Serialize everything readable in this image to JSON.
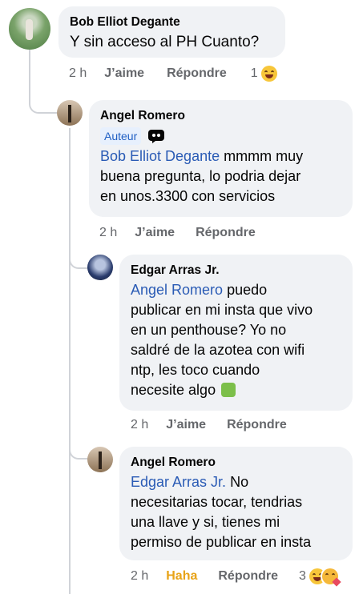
{
  "comments": [
    {
      "author": "Bob Elliot Degante",
      "text": "Y sin acceso al PH Cuanto?",
      "time": "2 h",
      "like": "J’aime",
      "reply": "Répondre",
      "reaction_count": "1"
    },
    {
      "author": "Angel Romero",
      "badge": "Auteur",
      "mention": "Bob Elliot Degante",
      "text_l1": " mmmm muy",
      "text_l2": "buena pregunta, lo podria dejar",
      "text_l3": "en unos.3300 con servicios",
      "time": "2 h",
      "like": "J’aime",
      "reply": "Répondre"
    },
    {
      "author": "Edgar Arras Jr.",
      "mention": "Angel Romero",
      "text_l1": " puedo",
      "text_l2": "publicar en mi insta que vivo",
      "text_l3": "en un penthouse? Yo no",
      "text_l4": "saldré de la azotea con wifi",
      "text_l5": "ntp, les toco cuando",
      "text_l6": "necesite algo",
      "time": "2 h",
      "like": "J’aime",
      "reply": "Répondre"
    },
    {
      "author": "Angel Romero",
      "mention": "Edgar Arras Jr.",
      "text_l1": " No",
      "text_l2": "necesitarias tocar, tendrias",
      "text_l3": "una llave y si, tienes mi",
      "text_l4": "permiso de publicar en insta",
      "time": "2 h",
      "like": "Haha",
      "reply": "Répondre",
      "reaction_count": "3"
    }
  ],
  "colors": {
    "haha": "#e8a317",
    "mention": "#2a5bb5",
    "meta": "#65676b",
    "bubble": "#f0f2f5"
  },
  "icons": [
    "laughing-emoji-icon",
    "love-emoji-icon",
    "top-fan-badge-icon",
    "person-facepalm-emoji-icon"
  ]
}
